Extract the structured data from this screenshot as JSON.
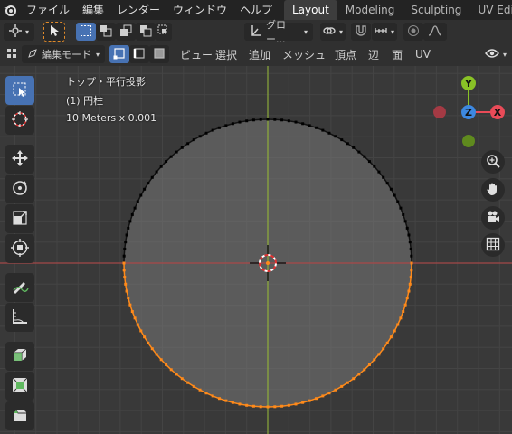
{
  "topbar": {
    "menus": [
      "ファイル",
      "編集",
      "レンダー",
      "ウィンドウ",
      "ヘルプ"
    ],
    "workspace_tabs": [
      {
        "label": "Layout",
        "active": true
      },
      {
        "label": "Modeling",
        "active": false
      },
      {
        "label": "Sculpting",
        "active": false
      },
      {
        "label": "UV Editir",
        "active": false
      }
    ]
  },
  "header": {
    "transform_orientation": "グロー...",
    "mode_dropdown": "編集モード",
    "menus": [
      "ビュー",
      "選択",
      "追加",
      "メッシュ",
      "頂点",
      "辺",
      "面",
      "UV"
    ]
  },
  "viewport": {
    "view_name": "トップ・平行投影",
    "object_name": "(1) 円柱",
    "scale_text": "10 Meters x 0.001"
  },
  "gizmo": {
    "y_label": "Y",
    "z_label": "Z",
    "x_label": "X",
    "colors": {
      "x": "#e94b58",
      "y": "#89c226",
      "z": "#3d88e0"
    }
  },
  "colors": {
    "accent": "#4772b3",
    "selected_vertex": "#ff8a1a",
    "x_axis": "#a34747",
    "y_axis": "#8ba83a"
  },
  "icons": {
    "toolbar": [
      "select-box-icon",
      "cursor-icon",
      "move-icon",
      "rotate-icon",
      "scale-icon",
      "transform-icon",
      "annotate-icon",
      "measure-icon",
      "extrude-icon",
      "inset-icon",
      "bevel-icon"
    ],
    "nav": [
      "zoom-icon",
      "hand-pan-icon",
      "camera-icon",
      "grid-ortho-icon"
    ]
  }
}
